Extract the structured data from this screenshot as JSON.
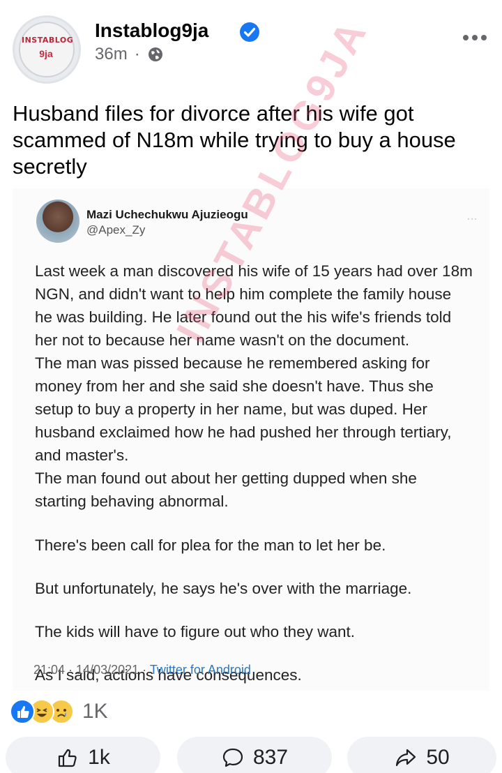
{
  "page": {
    "name": "Instablog9ja",
    "avatar_text_top": "INSTABLOG",
    "avatar_text_bottom": "9ja",
    "time": "36m",
    "separator": "·"
  },
  "post": {
    "text": "Husband files for divorce after his wife got scammed of N18m while trying to buy a house secretly"
  },
  "tweet": {
    "author_name": "Mazi Uchechukwu Ajuzieogu",
    "handle": "@Apex_Zy",
    "more": "···",
    "lines": [
      "Last week a man discovered his wife of 15 years had over 18m",
      "NGN, and didn't want to help him complete the family house",
      "he was building. He later found out the his wife's friends told",
      "her not to because her name wasn't on the document.",
      "The man was pissed because he remembered asking for",
      "money from her and she said she doesn't have. Thus she",
      "setup to buy a property in her name, but was duped. Her",
      "husband exclaimed how he had pushed her through tertiary,",
      "and master's.",
      "The man found out about her getting dupped when she",
      "starting behaving abnormal."
    ],
    "lines2": [
      "There's been call for plea for the man to let her be.",
      "But unfortunately, he says he's over with the marriage.",
      "The kids will have to figure out who they want.",
      "As I said, actions have consequences."
    ],
    "timestamp": "21:04 · 14/03/2021 · ",
    "source": "Twitter for Android",
    "watermark": "INSTABLOG9JA"
  },
  "reactions": {
    "icons": [
      "like-reaction-icon",
      "haha-reaction-icon",
      "sad-reaction-icon"
    ],
    "count": "1K"
  },
  "actions": {
    "like_count": "1k",
    "comment_count": "837",
    "share_count": "50"
  },
  "colors": {
    "accent": "#1877f2",
    "secondary_text": "#65676b",
    "watermark": "#e84c6e"
  }
}
